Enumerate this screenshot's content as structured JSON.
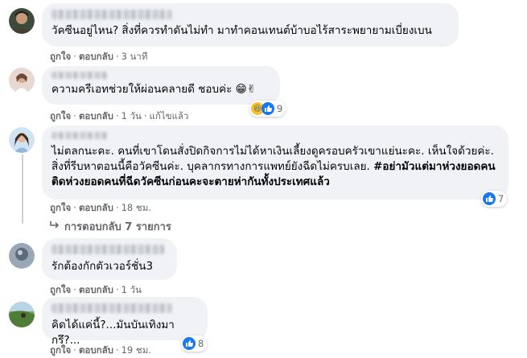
{
  "actions": {
    "like": "ถูกใจ",
    "reply": "ตอบกลับ",
    "dot": "·"
  },
  "comments": [
    {
      "text": "วัคซีนอยู่ไหน? สิ่งที่ควรทำดันไม่ทำ มาทำคอนเทนต์บ้าบอไร้สาระพยายามเบี่ยงเบน",
      "time": "3 นาที"
    },
    {
      "text": "ความครีเอทช่วยให้ผ่อนคลายดี ชอบค่ะ",
      "time": "1 วัน",
      "edited": "แก้ไขแล้ว",
      "reactions": {
        "count": "9",
        "icons": [
          "haha",
          "like"
        ]
      }
    },
    {
      "text_normal": "ไม่ตลกนะคะ. คนที่เขาโดนสั่งปิดกิจการไม่ได้หาเงินเลี้ยงดูครอบครัวเขาแย่นะคะ. เห็นใจด้วยค่ะ. สิ่งที่รีบหาตอนนี้คือวัคซีนค่ะ. บุคลากรทางการแพทย์ยังฉีดไม่ครบเลย.",
      "text_bold": "#อย่ามัวแต่มาห่วงยอดคนติดห่วงยอดคนที่ฉีดวัคซีนก่อนคะจะตายห่ากันทั้งประเทศแล้ว",
      "time": "18 ชม.",
      "reactions": {
        "count": "7",
        "icons": [
          "like"
        ]
      },
      "replies_label": "การตอบกลับ 7 รายการ"
    },
    {
      "text": "รักต้องกักตัวเวอร์ชั่น3",
      "time": "1 วัน"
    },
    {
      "text": "คิดได้แค่นี้?...มันบันเทิงมากรึ?...",
      "time": "19 ชม.",
      "reactions": {
        "count": "8",
        "icons": [
          "like"
        ]
      }
    }
  ],
  "colors": {
    "like": "#1877f2",
    "bubble": "#f0f2f5",
    "meta": "#65676b"
  }
}
